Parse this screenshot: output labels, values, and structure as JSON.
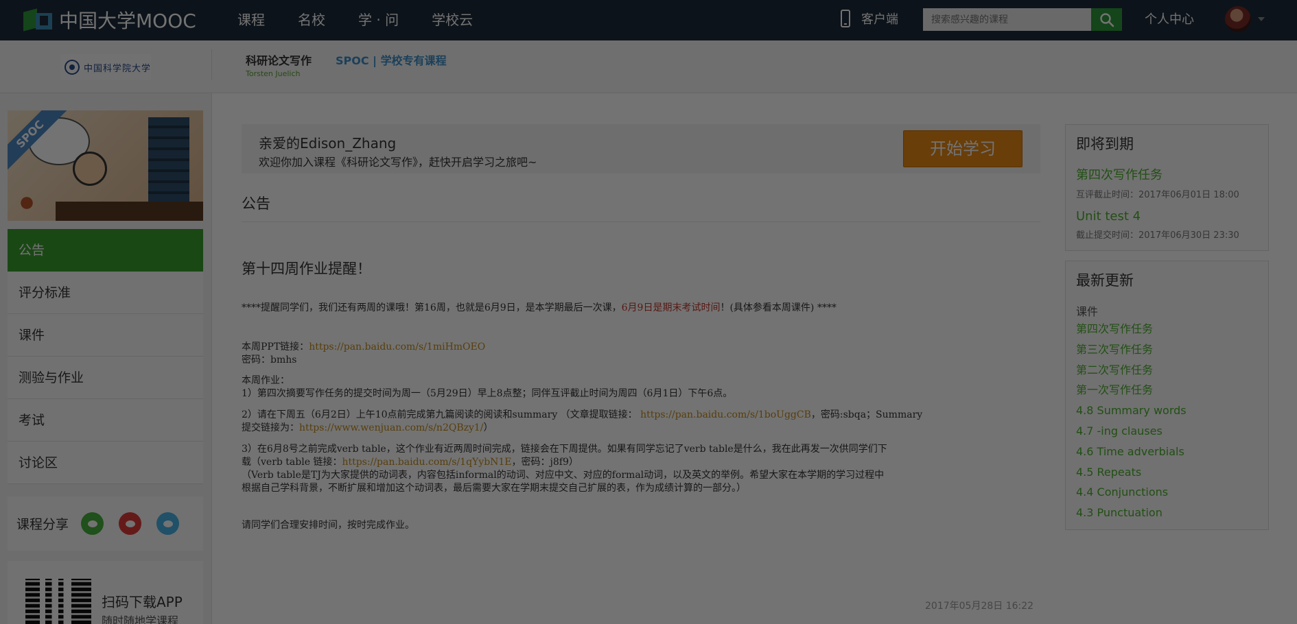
{
  "topbar": {
    "logo_text": "中国大学MOOC",
    "nav": [
      "课程",
      "名校",
      "学 · 问",
      "学校云"
    ],
    "client_label": "客户端",
    "search_placeholder": "搜索感兴趣的课程",
    "personal_center": "个人中心"
  },
  "course": {
    "school_name": "中国科学院大学",
    "title": "科研论文写作",
    "teacher": "Torsten Juelich",
    "type": "SPOC | 学校专有课程"
  },
  "sidebar": {
    "banner_label": "SPOC",
    "items": [
      "公告",
      "评分标准",
      "课件",
      "测验与作业",
      "考试",
      "讨论区"
    ],
    "active_index": 0,
    "share_label": "课程分享",
    "app_title": "扫码下载APP",
    "app_subtitle": "随时随地学课程"
  },
  "welcome": {
    "greeting": "亲爱的Edison_Zhang",
    "message": "欢迎你加入课程《科研论文写作》，赶快开启学习之旅吧~",
    "start_button": "开始学习"
  },
  "announcements": {
    "section_title": "公告",
    "title": "第十四周作业提醒！",
    "line1_a": "****提醒同学们，我们还有两周的课哦！第16周，也就是6月9日，是本学期最后一次课，",
    "line1_red": "6月9日是期末考试时间",
    "line1_b": "！(具体参看本周课件) ****",
    "ppt_label": "本周PPT链接：",
    "ppt_link": "https://pan.baidu.com/s/1miHmOEO",
    "password_line": "密码：bmhs",
    "hw_label": "本周作业：",
    "hw1": "1）第四次摘要写作任务的提交时间为周一（5月29日）早上8点整；同伴互评截止时间为周四（6月1日）下午6点。",
    "hw2_a": "2）请在下周五（6月2日）上午10点前完成第九篇阅读的阅读和summary （文章提取链接： ",
    "hw2_link1": "https://pan.baidu.com/s/1boUggCB",
    "hw2_b": "，密码:sbqa；Summary",
    "hw2_c": "提交链接为：",
    "hw2_link2": "https://www.wenjuan.com/s/n2QBzy1/",
    "hw2_d": "）",
    "hw3_a": "3）在6月8号之前完成verb table，这个作业有近两周时间完成，链接会在下周提供。如果有同学忘记了verb table是什么，我在此再发一次供同学们下",
    "hw3_b": "载（verb table 链接：",
    "hw3_link": "https://pan.baidu.com/s/1qYybN1E",
    "hw3_c": "，密码：j8f9）",
    "hw3_d": "（Verb table是TJ为大家提供的动词表，内容包括informal的动词、对应中文、对应的formal动词，以及英文的举例。希望大家在本学期的学习过程中",
    "hw3_e": "根据自己学科背景，不断扩展和增加这个动词表，最后需要大家在学期末提交自己扩展的表，作为成绩计算的一部分。）",
    "closing": "请同学们合理安排时间，按时完成作业。",
    "date": "2017年05月28日 16:22"
  },
  "due_soon": {
    "title": "即将到期",
    "items": [
      {
        "name": "第四次写作任务",
        "meta": "互评截止时间：2017年06月01日 18:00"
      },
      {
        "name": "Unit test 4",
        "meta": "截止提交时间：2017年06月30日 23:30"
      }
    ]
  },
  "updates": {
    "title": "最新更新",
    "category": "课件",
    "items": [
      "第四次写作任务",
      "第三次写作任务",
      "第二次写作任务",
      "第一次写作任务",
      "4.8 Summary words",
      "4.7 -ing clauses",
      "4.6 Time adverbials",
      "4.5 Repeats",
      "4.4 Conjunctions",
      "4.3 Punctuation"
    ]
  },
  "colors": {
    "topbar": "#1d2a3a",
    "accent_green": "#3aa02f",
    "link_green": "#4caf2e",
    "start_orange": "#e98a14",
    "spoc_blue": "#3d8fc8",
    "alert_red": "#c0392b",
    "link_gold": "#c28a1a"
  }
}
